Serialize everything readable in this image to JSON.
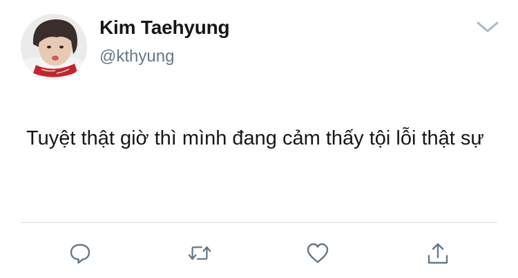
{
  "user": {
    "display_name": "Kim Taehyung",
    "handle": "@kthyung",
    "avatar": "profile-photo"
  },
  "tweet": {
    "text": "Tuyệt thật giờ thì mình đang cảm thấy tội lỗi thật sự"
  },
  "icons": {
    "menu": "chevron-down-icon",
    "reply": "reply-icon",
    "retweet": "retweet-icon",
    "like": "heart-icon",
    "share": "share-icon"
  },
  "colors": {
    "text": "#14171a",
    "secondary": "#657786",
    "icon": "#657786",
    "caret": "#aab8c2",
    "divider": "#d6dde3"
  }
}
